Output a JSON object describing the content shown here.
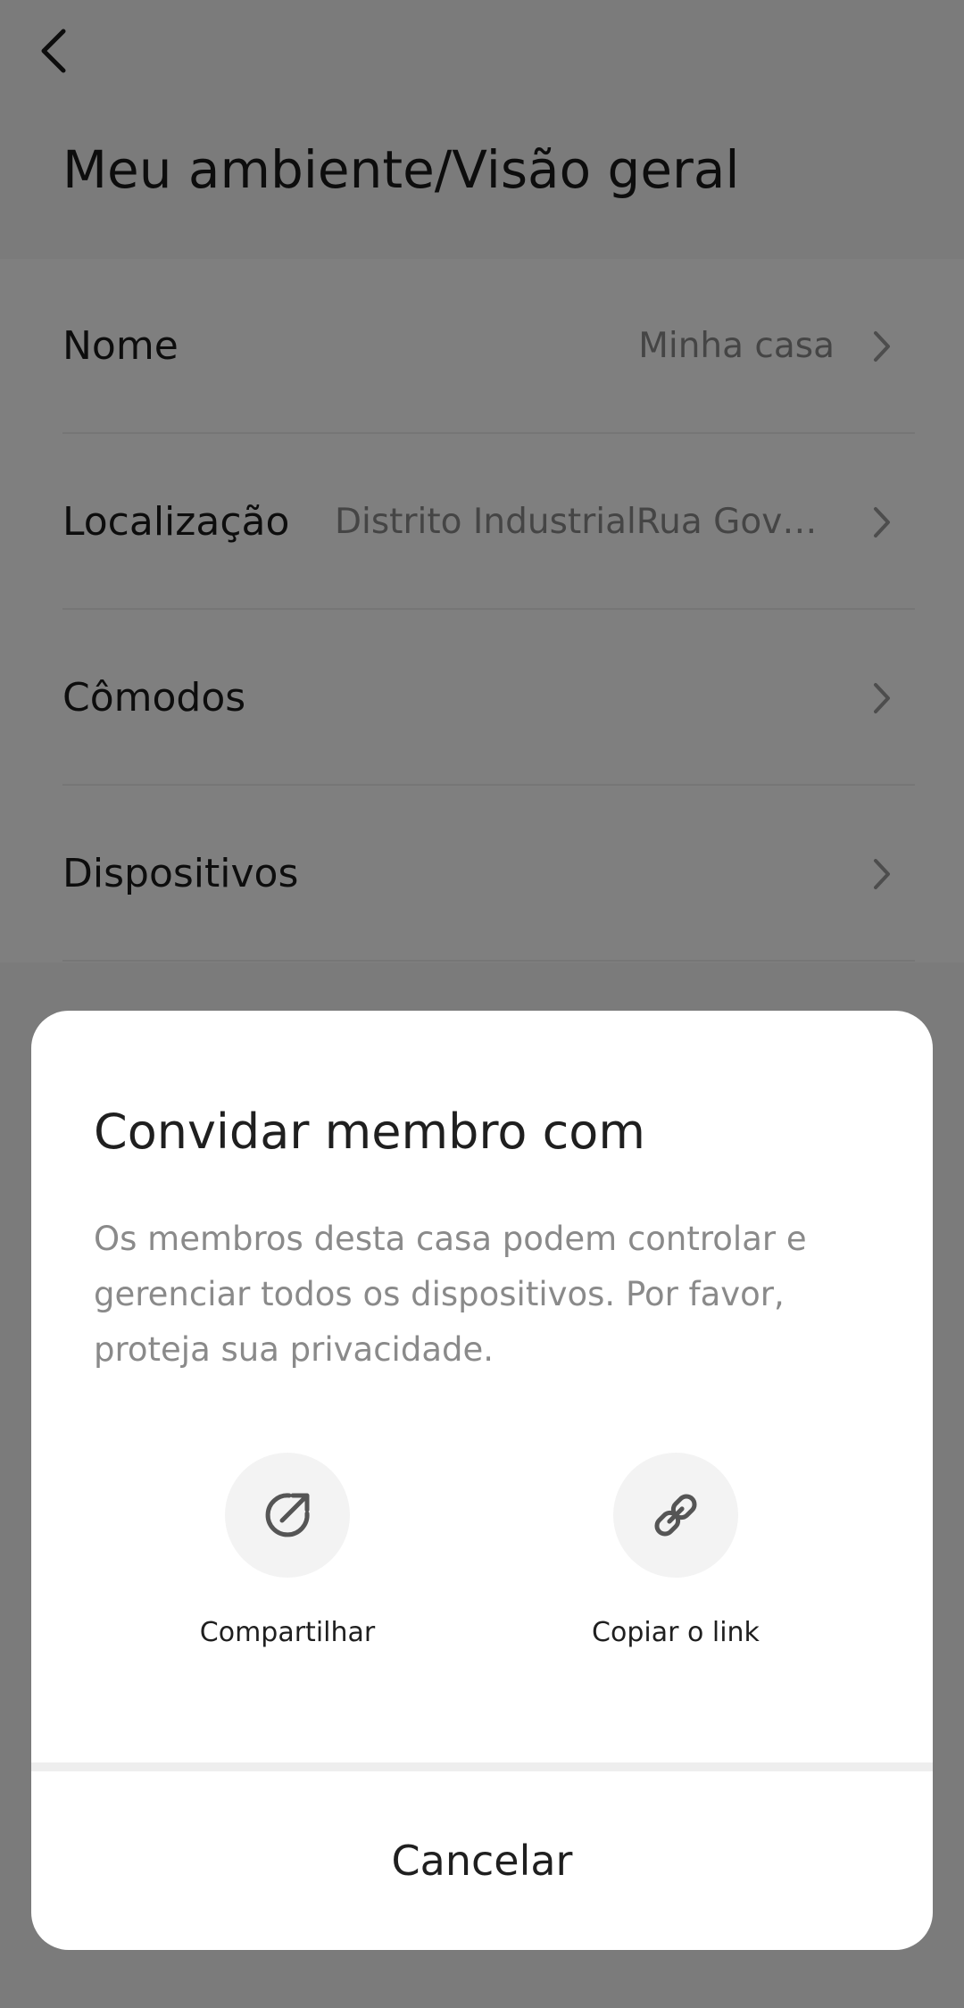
{
  "header": {
    "title": "Meu ambiente/Visão geral",
    "back_icon": "chevron-left-icon"
  },
  "settings": {
    "rows": [
      {
        "label": "Nome",
        "value": "Minha casa"
      },
      {
        "label": "Localização",
        "value": "Distrito IndustrialRua Govern..."
      },
      {
        "label": "Cômodos",
        "value": ""
      },
      {
        "label": "Dispositivos",
        "value": ""
      }
    ]
  },
  "dialog": {
    "title": "Convidar membro com",
    "description": "Os membros desta casa podem controlar e gerenciar todos os dispositivos. Por favor, proteja sua privacidade.",
    "options": [
      {
        "label": "Compartilhar",
        "icon": "share-icon"
      },
      {
        "label": "Copiar o link",
        "icon": "link-icon"
      }
    ],
    "cancel_label": "Cancelar"
  },
  "colors": {
    "scrim": "#000000",
    "dialog_bg": "#ffffff",
    "icon_circle_bg": "#f3f3f3",
    "secondary_text": "#8a8a8a"
  }
}
